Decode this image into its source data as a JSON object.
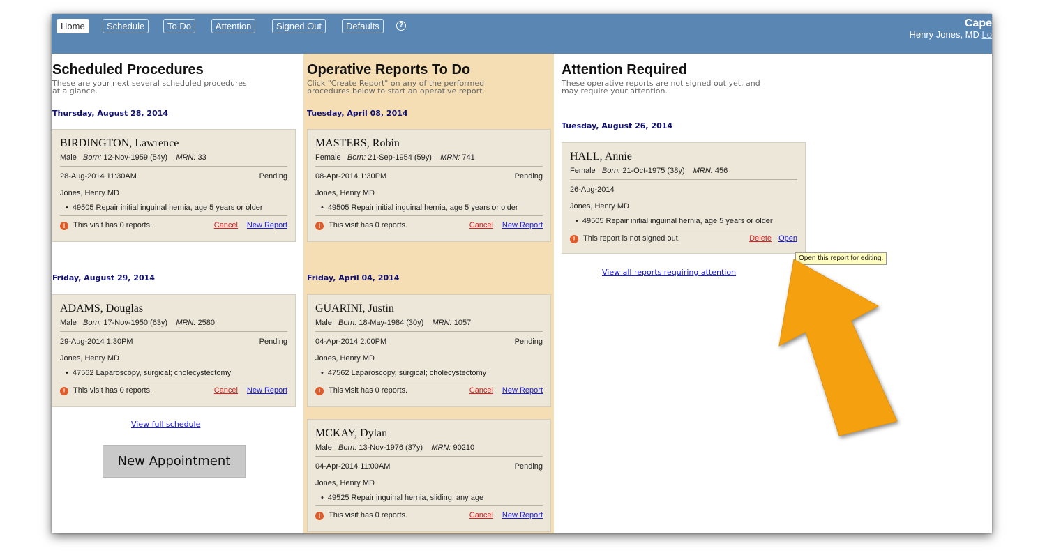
{
  "nav": {
    "tabs": [
      "Home",
      "Schedule",
      "To Do",
      "Attention",
      "Signed Out",
      "Defaults"
    ],
    "help_glyph": "?",
    "brand": "Cape",
    "user": "Henry Jones, MD",
    "logout": "Lo"
  },
  "scheduled": {
    "title": "Scheduled Procedures",
    "desc_line1": "These are your next several scheduled procedures",
    "desc_line2": "at a glance.",
    "groups": [
      {
        "date": "Thursday, August 28, 2014",
        "cards": [
          {
            "name": "BIRDINGTON, Lawrence",
            "sex": "Male",
            "born_label": "Born:",
            "born": "12-Nov-1959 (54y)",
            "mrn_label": "MRN:",
            "mrn": "33",
            "datetime": "28-Aug-2014 11:30AM",
            "status": "Pending",
            "surgeon": "Jones, Henry MD",
            "procedure": "49505 Repair initial inguinal hernia, age 5 years or older",
            "note": "This visit has 0 reports.",
            "action1": "Cancel",
            "action2": "New Report"
          }
        ]
      },
      {
        "date": "Friday, August 29, 2014",
        "cards": [
          {
            "name": "ADAMS, Douglas",
            "sex": "Male",
            "born_label": "Born:",
            "born": "17-Nov-1950 (63y)",
            "mrn_label": "MRN:",
            "mrn": "2580",
            "datetime": "29-Aug-2014 1:30PM",
            "status": "Pending",
            "surgeon": "Jones, Henry MD",
            "procedure": "47562 Laparoscopy, surgical; cholecystectomy",
            "note": "This visit has 0 reports.",
            "action1": "Cancel",
            "action2": "New Report"
          }
        ]
      }
    ],
    "view_link": "View full schedule",
    "new_appt": "New Appointment"
  },
  "todo": {
    "title": "Operative Reports To Do",
    "desc_line1": "Click \"Create Report\" on any of the performed",
    "desc_line2": "procedures below to start an operative report.",
    "groups": [
      {
        "date": "Tuesday, April 08, 2014",
        "cards": [
          {
            "name": "MASTERS, Robin",
            "sex": "Female",
            "born_label": "Born:",
            "born": "21-Sep-1954 (59y)",
            "mrn_label": "MRN:",
            "mrn": "741",
            "datetime": "08-Apr-2014 1:30PM",
            "status": "Pending",
            "surgeon": "Jones, Henry MD",
            "procedure": "49505 Repair initial inguinal hernia, age 5 years or older",
            "note": "This visit has 0 reports.",
            "action1": "Cancel",
            "action2": "New Report"
          }
        ]
      },
      {
        "date": "Friday, April 04, 2014",
        "cards": [
          {
            "name": "GUARINI, Justin",
            "sex": "Male",
            "born_label": "Born:",
            "born": "18-May-1984 (30y)",
            "mrn_label": "MRN:",
            "mrn": "1057",
            "datetime": "04-Apr-2014 2:00PM",
            "status": "Pending",
            "surgeon": "Jones, Henry MD",
            "procedure": "47562 Laparoscopy, surgical; cholecystectomy",
            "note": "This visit has 0 reports.",
            "action1": "Cancel",
            "action2": "New Report"
          },
          {
            "name": "MCKAY, Dylan",
            "sex": "Male",
            "born_label": "Born:",
            "born": "13-Nov-1976 (37y)",
            "mrn_label": "MRN:",
            "mrn": "90210",
            "datetime": "04-Apr-2014 11:00AM",
            "status": "Pending",
            "surgeon": "Jones, Henry MD",
            "procedure": "49525 Repair inguinal hernia, sliding, any age",
            "note": "This visit has 0 reports.",
            "action1": "Cancel",
            "action2": "New Report"
          }
        ]
      }
    ]
  },
  "attention": {
    "title": "Attention Required",
    "desc_line1": "These operative reports are not signed out yet, and",
    "desc_line2": "may require your attention.",
    "groups": [
      {
        "date": "Tuesday, August 26, 2014",
        "cards": [
          {
            "name": "HALL, Annie",
            "sex": "Female",
            "born_label": "Born:",
            "born": "21-Oct-1975 (38y)",
            "mrn_label": "MRN:",
            "mrn": "456",
            "datetime": "26-Aug-2014",
            "surgeon": "Jones, Henry MD",
            "procedure": "49505 Repair initial inguinal hernia, age 5 years or older",
            "note": "This report is not signed out.",
            "action1": "Delete",
            "action2": "Open"
          }
        ]
      }
    ],
    "view_link": "View all reports requiring attention",
    "tooltip": "Open this report for editing."
  },
  "colors": {
    "topbar": "#5a86b4",
    "todo_bg": "#f5deb3",
    "card_bg": "#ede7da",
    "arrow": "#f5a00f",
    "link_blue": "#1a1ae6",
    "link_red": "#e02020"
  },
  "icons": {
    "warning": "warning-icon",
    "help": "help-icon",
    "arrow": "pointer-arrow"
  }
}
